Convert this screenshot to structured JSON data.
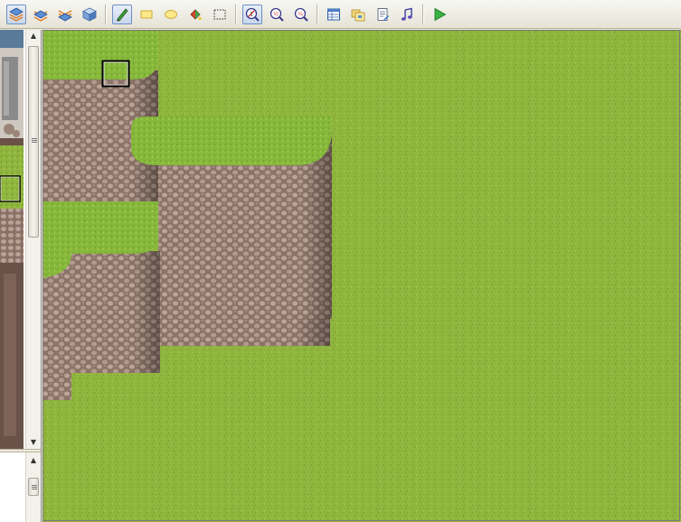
{
  "toolbar": {
    "buttons": [
      {
        "name": "layer-1-button",
        "icon": "layer-stack-blue-icon",
        "active": true
      },
      {
        "name": "layer-2-button",
        "icon": "layer-stack-orange-icon",
        "active": false
      },
      {
        "name": "layer-3-button",
        "icon": "layer-stack-multi-icon",
        "active": false
      },
      {
        "name": "event-layer-button",
        "icon": "cube-icon",
        "active": false
      },
      {
        "name": "pencil-tool-button",
        "icon": "pencil-icon",
        "active": true
      },
      {
        "name": "rectangle-tool-button",
        "icon": "rectangle-icon",
        "active": false
      },
      {
        "name": "ellipse-tool-button",
        "icon": "ellipse-icon",
        "active": false
      },
      {
        "name": "fill-tool-button",
        "icon": "fill-bucket-icon",
        "active": false
      },
      {
        "name": "select-tool-button",
        "icon": "dashed-select-icon",
        "active": false
      },
      {
        "name": "zoom-1x-button",
        "icon": "zoom-1x-icon",
        "active": true
      },
      {
        "name": "zoom-2x-button",
        "icon": "zoom-half-icon",
        "active": false
      },
      {
        "name": "zoom-4x-button",
        "icon": "zoom-quarter-icon",
        "active": false
      },
      {
        "name": "database-button",
        "icon": "table-icon",
        "active": false
      },
      {
        "name": "materialbase-button",
        "icon": "folders-icon",
        "active": false
      },
      {
        "name": "script-editor-button",
        "icon": "notepad-icon",
        "active": false
      },
      {
        "name": "sound-test-button",
        "icon": "music-note-icon",
        "active": false
      },
      {
        "name": "playtest-button",
        "icon": "play-icon",
        "active": false
      }
    ]
  },
  "colors": {
    "grass": "#8fb53e",
    "grass_dark": "#6f9a2a",
    "rock": "#a88e80",
    "rock_dark": "#6b544b",
    "selection": "#000000"
  }
}
